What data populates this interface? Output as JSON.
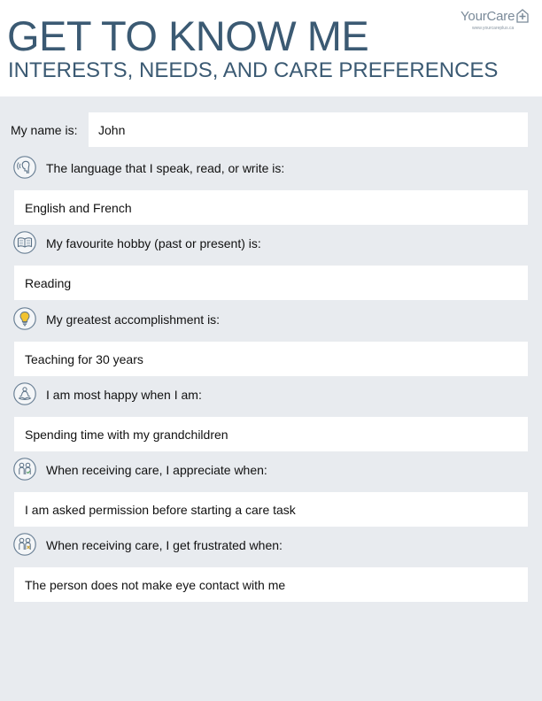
{
  "header": {
    "title": "GET TO KNOW ME",
    "subtitle": "INTERESTS, NEEDS, AND CARE PREFERENCES",
    "logo_text": "YourCare",
    "logo_url": "www.yourcareplus.ca"
  },
  "name": {
    "label": "My name is:",
    "value": "John"
  },
  "sections": [
    {
      "icon": "head-speaking-icon",
      "question": "The language that I speak, read, or write is:",
      "answer": "English and French"
    },
    {
      "icon": "open-book-icon",
      "question": "My favourite hobby (past or present) is:",
      "answer": "Reading"
    },
    {
      "icon": "lightbulb-icon",
      "question": "My greatest accomplishment is:",
      "answer": "Teaching for 30 years"
    },
    {
      "icon": "meditation-icon",
      "question": "I am most happy when I am:",
      "answer": "Spending time with my grandchildren"
    },
    {
      "icon": "people-check-icon",
      "question": "When receiving care, I appreciate when:",
      "answer": "I am asked permission before starting a care task"
    },
    {
      "icon": "people-cross-icon",
      "question": "When receiving care, I get frustrated when:",
      "answer": "The person does not make eye contact with me"
    }
  ],
  "colors": {
    "title": "#3b5a73",
    "background": "#e8ebef",
    "icon_stroke": "#5a7186",
    "lightbulb": "#f2c330"
  }
}
